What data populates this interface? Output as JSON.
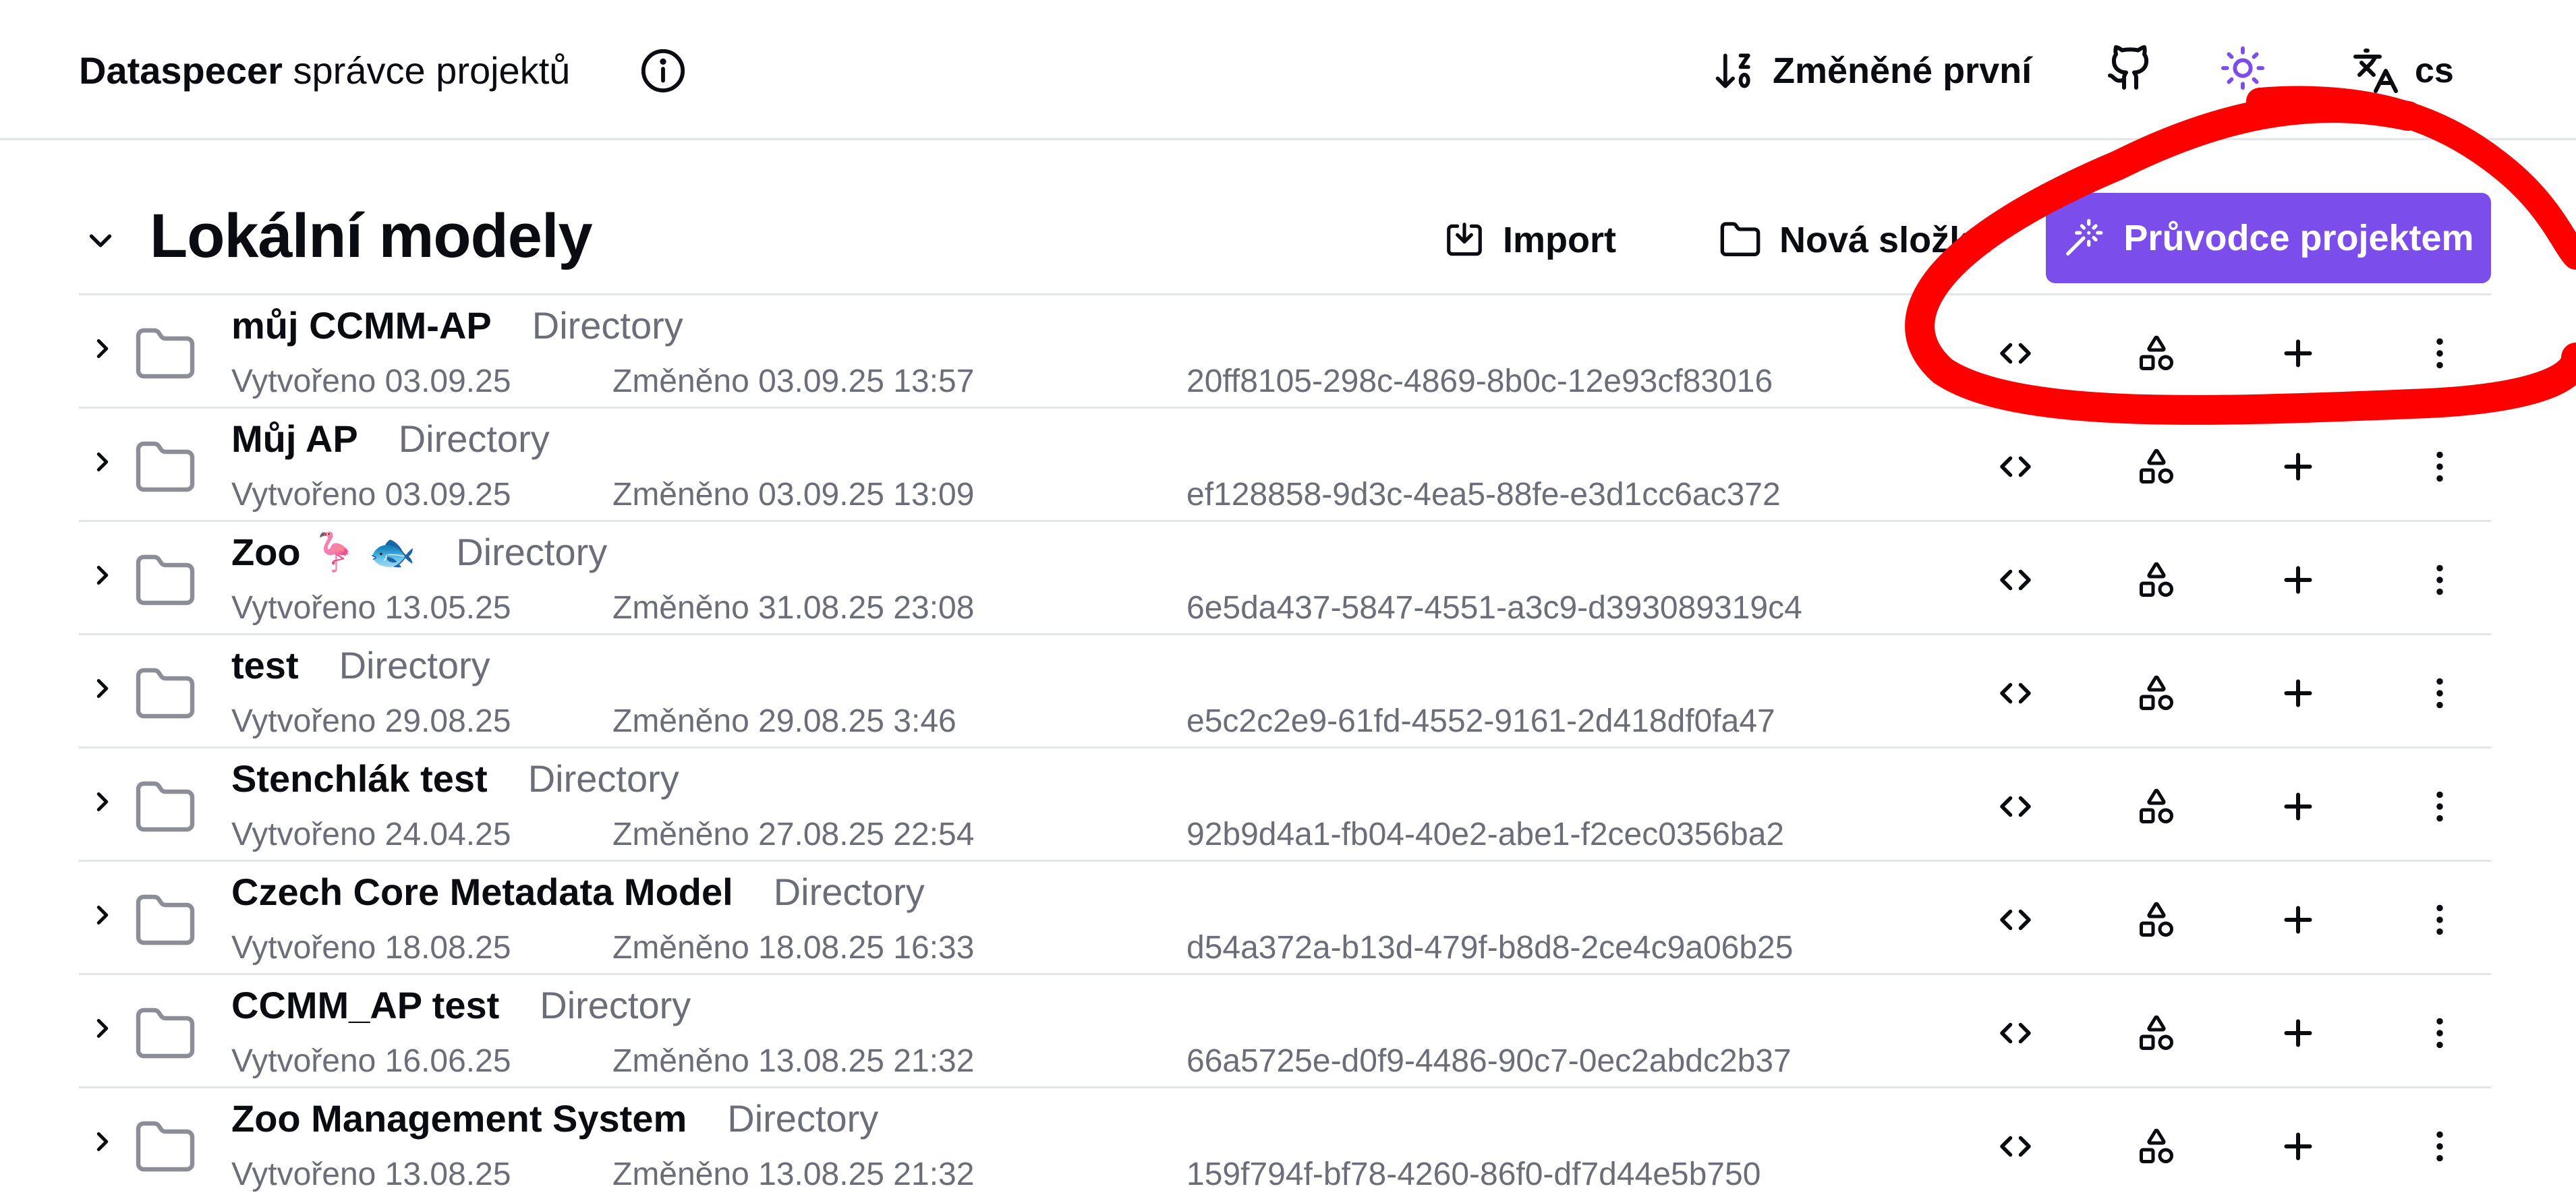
{
  "header": {
    "brand_strong": "Dataspecer",
    "brand_rest": " správce projektů",
    "sort_label": "Změněné první",
    "language": "cs"
  },
  "section": {
    "title": "Lokální modely",
    "import_label": "Import",
    "new_folder_label": "Nová složka",
    "wizard_label": "Průvodce projektem"
  },
  "colors": {
    "accent": "#7b4dea",
    "annotation": "#ff0000",
    "muted": "#6b6e78"
  },
  "icons": [
    "info-icon",
    "sort-icon",
    "github-icon",
    "sun-icon",
    "language-icon",
    "chevron-down-icon",
    "import-icon",
    "folder-icon",
    "wand-icon",
    "chevron-right-icon",
    "code-icon",
    "shapes-icon",
    "plus-icon",
    "more-vertical-icon"
  ],
  "projects": [
    {
      "name": "můj CCMM-AP",
      "type": "Directory",
      "created": "Vytvořeno 03.09.25",
      "modified": "Změněno 03.09.25 13:57",
      "uuid": "20ff8105-298c-4869-8b0c-12e93cf83016"
    },
    {
      "name": "Můj AP",
      "type": "Directory",
      "created": "Vytvořeno 03.09.25",
      "modified": "Změněno 03.09.25 13:09",
      "uuid": "ef128858-9d3c-4ea5-88fe-e3d1cc6ac372"
    },
    {
      "name": "Zoo 🦩 🐟",
      "type": "Directory",
      "created": "Vytvořeno 13.05.25",
      "modified": "Změněno 31.08.25 23:08",
      "uuid": "6e5da437-5847-4551-a3c9-d393089319c4"
    },
    {
      "name": "test",
      "type": "Directory",
      "created": "Vytvořeno 29.08.25",
      "modified": "Změněno 29.08.25 3:46",
      "uuid": "e5c2c2e9-61fd-4552-9161-2d418df0fa47"
    },
    {
      "name": "Stenchlák test",
      "type": "Directory",
      "created": "Vytvořeno 24.04.25",
      "modified": "Změněno 27.08.25 22:54",
      "uuid": "92b9d4a1-fb04-40e2-abe1-f2cec0356ba2"
    },
    {
      "name": "Czech Core Metadata Model",
      "type": "Directory",
      "created": "Vytvořeno 18.08.25",
      "modified": "Změněno 18.08.25 16:33",
      "uuid": "d54a372a-b13d-479f-b8d8-2ce4c9a06b25"
    },
    {
      "name": "CCMM_AP test",
      "type": "Directory",
      "created": "Vytvořeno 16.06.25",
      "modified": "Změněno 13.08.25 21:32",
      "uuid": "66a5725e-d0f9-4486-90c7-0ec2abdc2b37"
    },
    {
      "name": "Zoo Management System",
      "type": "Directory",
      "created": "Vytvořeno 13.08.25",
      "modified": "Změněno 13.08.25 21:32",
      "uuid": "159f794f-bf78-4260-86f0-df7d44e5b750"
    }
  ]
}
